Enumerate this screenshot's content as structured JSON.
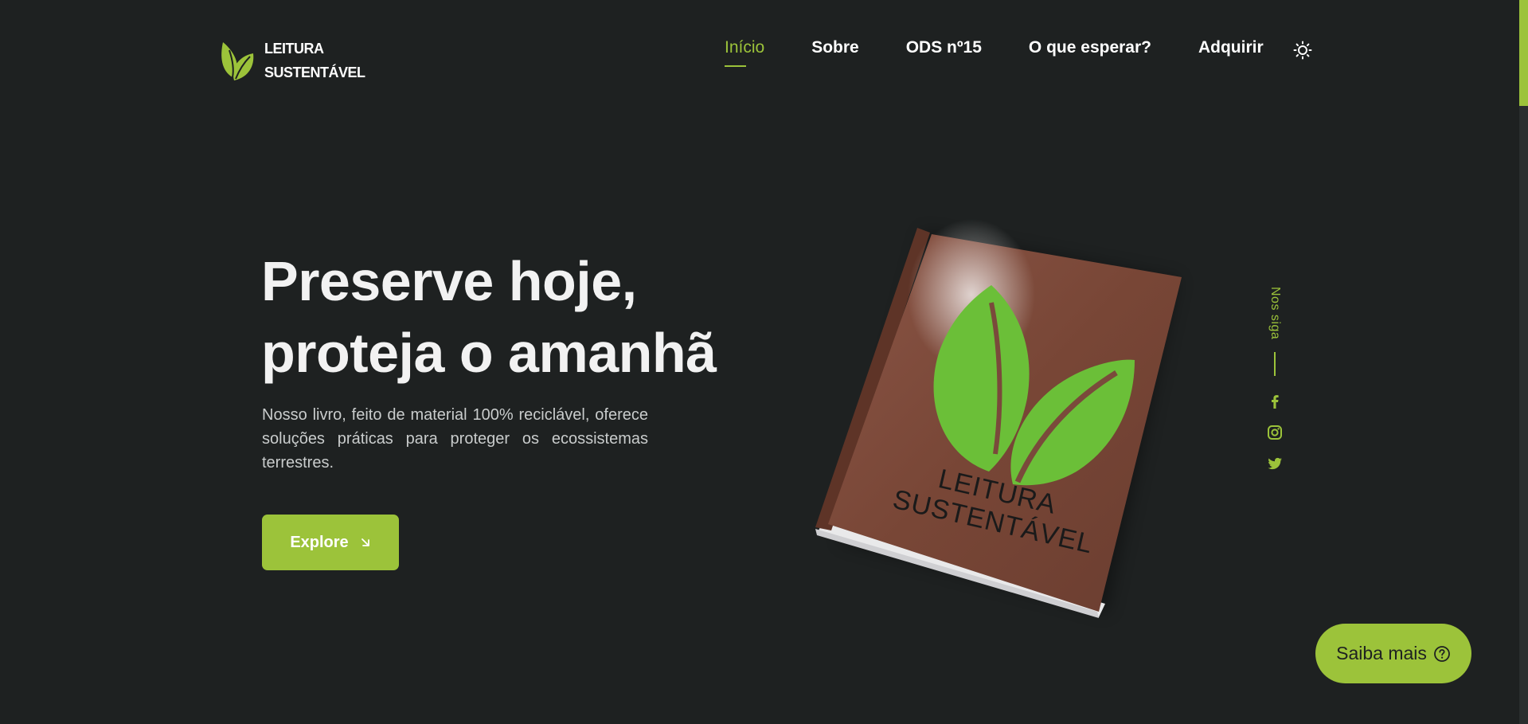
{
  "brand": {
    "name": "LEITURA\nSUSTENTÁVEL",
    "accent": "#9cc33a",
    "background": "#1e2121"
  },
  "nav": {
    "items": [
      {
        "label": "Início",
        "active": true
      },
      {
        "label": "Sobre",
        "active": false
      },
      {
        "label": "ODS nº15",
        "active": false
      },
      {
        "label": "O que esperar?",
        "active": false
      },
      {
        "label": "Adquirir",
        "active": false
      }
    ],
    "theme_toggle_icon": "sun-icon"
  },
  "hero": {
    "title": "Preserve hoje, proteja o amanhã",
    "description": "Nosso livro, feito de material 100% reciclável, oferece soluções práticas para proteger os ecossistemas terrestres.",
    "cta_label": "Explore",
    "cta_icon": "arrow-down-right-icon"
  },
  "book": {
    "title": "LEITURA\nSUSTENTÁVEL",
    "cover_color": "#7a4a3b",
    "leaf_color": "#6bbf38"
  },
  "social": {
    "label": "Nos siga",
    "icons": [
      "facebook-icon",
      "instagram-icon",
      "twitter-icon"
    ]
  },
  "help_button": {
    "label": "Saiba mais",
    "icon": "question-circle-icon"
  }
}
